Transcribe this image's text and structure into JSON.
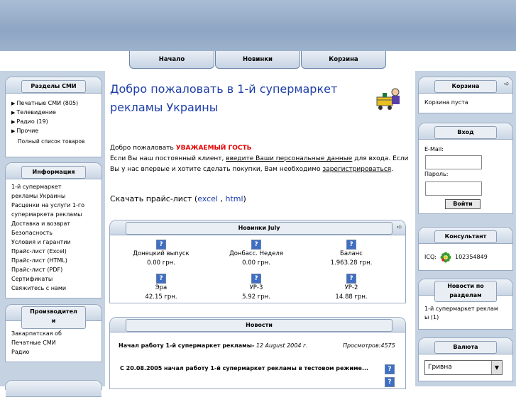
{
  "nav": {
    "items": [
      "Начало",
      "Новинки",
      "Корзина"
    ]
  },
  "left": {
    "sections": {
      "title": "Разделы СМИ",
      "items": [
        "Печатные СМИ (805)",
        "Телевидение",
        "Радио (19)",
        "Прочие"
      ],
      "full_list": "Полный список товаров"
    },
    "info": {
      "title": "Информация",
      "items": [
        "1-й супермаркет",
        "рекламы Украины",
        "Расценки на услуги 1-го",
        "супермаркета рекламы",
        "Доставка и возврат",
        "Безопасность",
        "Условия и гарантии",
        "Прайс-лист (Excel)",
        "Прайс-лист (HTML)",
        "Прайс-лист (PDF)",
        "Сертификаты",
        "Свяжитесь с нами"
      ]
    },
    "producers": {
      "title_line1": "Производител",
      "title_line2": "и",
      "items": [
        "Закарпатская об",
        "Печатные СМИ",
        "Радио"
      ]
    }
  },
  "main": {
    "heading_line1": "Добро пожаловать в 1-й супермаркет",
    "heading_line2": "рекламы Украины",
    "welcome_prefix": "Добро пожаловать",
    "guest": "УВАЖАЕМЫЙ ГОСТЬ",
    "line2_prefix": "Если Вы наш постоянный клиент,",
    "line2_link": "введите Ваши персональные данные",
    "line2_suffix": "для входа. Если",
    "line3_prefix": "Вы у нас впервые и хотите сделать покупки, Вам необходимо",
    "line3_link": "зарегистрироваться",
    "line3_suffix": ".",
    "price_prefix": "Скачать прайс-лист (",
    "price_excel": "excel",
    "price_sep": " , ",
    "price_html": "html",
    "price_suffix": ")"
  },
  "new_panel": {
    "title": "Новинки July",
    "products": [
      {
        "name": "Донецкий выпуск",
        "price": "0.00 грн."
      },
      {
        "name": "Донбасс. Неделя",
        "price": "0.00 грн."
      },
      {
        "name": "Баланс",
        "price": "1.963.28 грн."
      },
      {
        "name": "Эра",
        "price": "42.15 грн."
      },
      {
        "name": "УР-3",
        "price": "5.92 грн."
      },
      {
        "name": "УР-2",
        "price": "14.88 грн."
      }
    ]
  },
  "news_panel": {
    "title": "Новости",
    "item_title": "Начал работу 1-й супермаркет рекламы-",
    "item_date": "12 August 2004 г.",
    "item_views": "Просмотров:4575",
    "item2": "С 20.08.2005 начал работу 1-й супермаркет рекламы в тестовом режиме..."
  },
  "right": {
    "cart": {
      "title": "Корзина",
      "text": "Корзина пуста"
    },
    "login": {
      "title": "Вход",
      "email_label": "E-Mail:",
      "password_label": "Пароль:",
      "button": "Войти"
    },
    "consultant": {
      "title": "Консультант",
      "icq_label": "ICQ:",
      "icq_number": "102354849"
    },
    "section_news": {
      "title_line1": "Новости по",
      "title_line2": "разделам",
      "text_line1": "1-й супермаркет реклам",
      "text_line2": "ы (1)"
    },
    "currency": {
      "title": "Валюта",
      "selected": "Гривна"
    }
  }
}
